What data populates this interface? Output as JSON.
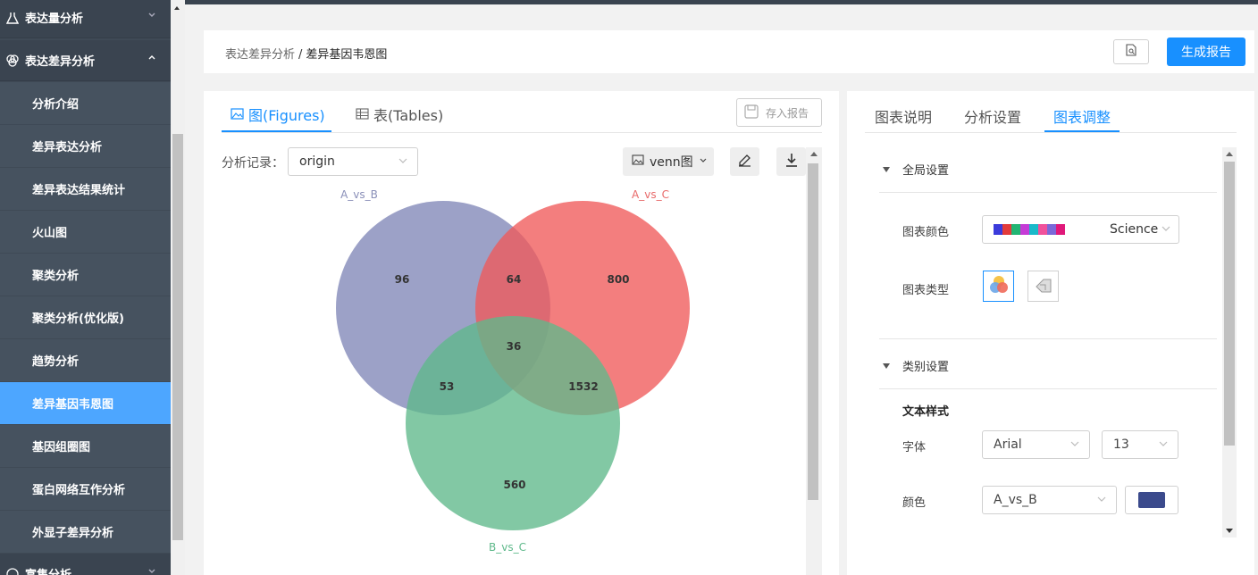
{
  "sidebar": {
    "groups": [
      {
        "label": "表达量分析",
        "expanded": false
      },
      {
        "label": "表达差异分析",
        "expanded": true
      },
      {
        "label": "富集分析",
        "expanded": false
      }
    ],
    "items": [
      {
        "label": "分析介绍"
      },
      {
        "label": "差异表达分析"
      },
      {
        "label": "差异表达结果统计"
      },
      {
        "label": "火山图"
      },
      {
        "label": "聚类分析"
      },
      {
        "label": "聚类分析(优化版)"
      },
      {
        "label": "趋势分析"
      },
      {
        "label": "差异基因韦恩图",
        "active": true
      },
      {
        "label": "基因组圈图"
      },
      {
        "label": "蛋白网络互作分析"
      },
      {
        "label": "外显子差异分析"
      }
    ]
  },
  "breadcrumb": {
    "parent": "表达差异分析",
    "separator": "/",
    "current": "差异基因韦恩图"
  },
  "header": {
    "report_button": "生成报告",
    "doc_icon": "document-icon"
  },
  "left_panel": {
    "tabs": [
      {
        "label": "图(Figures)",
        "active": true
      },
      {
        "label": "表(Tables)",
        "active": false
      }
    ],
    "save_button": "存入报告",
    "record_label": "分析记录：",
    "record_value": "origin",
    "chart_type_value": "venn图"
  },
  "venn": {
    "sets": [
      {
        "name": "A_vs_B",
        "color": "#7b82b4",
        "label_color": "#8a8fb8"
      },
      {
        "name": "A_vs_C",
        "color": "#f05a5a",
        "label_color": "#e86a6a"
      },
      {
        "name": "B_vs_C",
        "color": "#5fb98b",
        "label_color": "#5fb98b"
      }
    ],
    "regions": {
      "A_only": "96",
      "AC": "64",
      "C_only": "800",
      "ABC": "36",
      "AB": "53",
      "BC": "1532",
      "B_only": "560"
    }
  },
  "right_panel": {
    "tabs": [
      {
        "label": "图表说明",
        "active": false
      },
      {
        "label": "分析设置",
        "active": false
      },
      {
        "label": "图表调整",
        "active": true
      }
    ],
    "global_section": "全局设置",
    "chart_color_label": "图表颜色",
    "chart_color_value": "Science",
    "palette": [
      "#3b3bdb",
      "#e23b3b",
      "#22b573",
      "#c53bd6",
      "#19b9c9",
      "#f0519b",
      "#7b68d8",
      "#e0197a"
    ],
    "chart_type_label": "图表类型",
    "category_section": "类别设置",
    "text_style_title": "文本样式",
    "font_label": "字体",
    "font_value": "Arial",
    "font_size_value": "13",
    "color_label": "颜色",
    "color_target_value": "A_vs_B",
    "color_swatch": "#3b4a8c"
  }
}
